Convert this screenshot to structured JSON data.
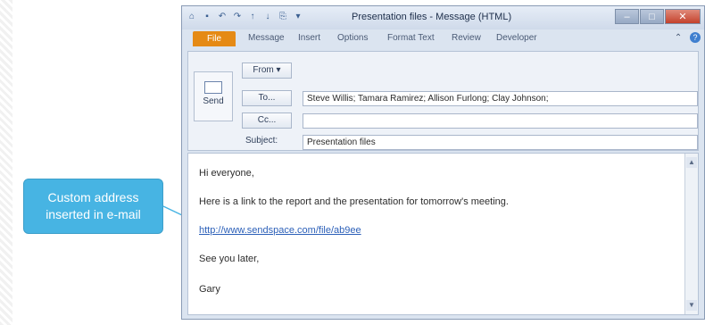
{
  "callout": {
    "line1": "Custom address",
    "line2": "inserted in e-mail"
  },
  "window": {
    "title": "Presentation files - Message (HTML)",
    "quick_access": [
      {
        "icon": "outlook-icon",
        "glyph": "⌂"
      },
      {
        "icon": "save-icon",
        "glyph": "▪"
      },
      {
        "icon": "undo-icon",
        "glyph": "↶"
      },
      {
        "icon": "redo-icon",
        "glyph": "↷"
      },
      {
        "icon": "up-arrow-icon",
        "glyph": "↑"
      },
      {
        "icon": "down-arrow-icon",
        "glyph": "↓"
      },
      {
        "icon": "attach-icon",
        "glyph": "⎘"
      },
      {
        "icon": "customize-icon",
        "glyph": "▾"
      }
    ],
    "controls": {
      "minimize": "–",
      "maximize": "□",
      "close": "✕"
    }
  },
  "ribbon": {
    "tabs": [
      "File",
      "Message",
      "Insert",
      "Options",
      "Format Text",
      "Review",
      "Developer"
    ],
    "collapse_glyph": "⌃",
    "help_glyph": "?"
  },
  "compose": {
    "send_label": "Send",
    "from_label": "From ▾",
    "to_label": "To...",
    "cc_label": "Cc...",
    "subject_label": "Subject:",
    "to_value": "Steve Willis; Tamara Ramirez; Allison Furlong; Clay Johnson;",
    "cc_value": "",
    "subject_value": "Presentation files"
  },
  "message_body": {
    "greeting": "Hi everyone,",
    "line1": "Here is a link to the report and the presentation for tomorrow's meeting.",
    "link": "http://www.sendspace.com/file/ab9ee",
    "closing": "See you later,",
    "signature": "Gary"
  },
  "scrollbar": {
    "up": "▲",
    "down": "▼"
  }
}
